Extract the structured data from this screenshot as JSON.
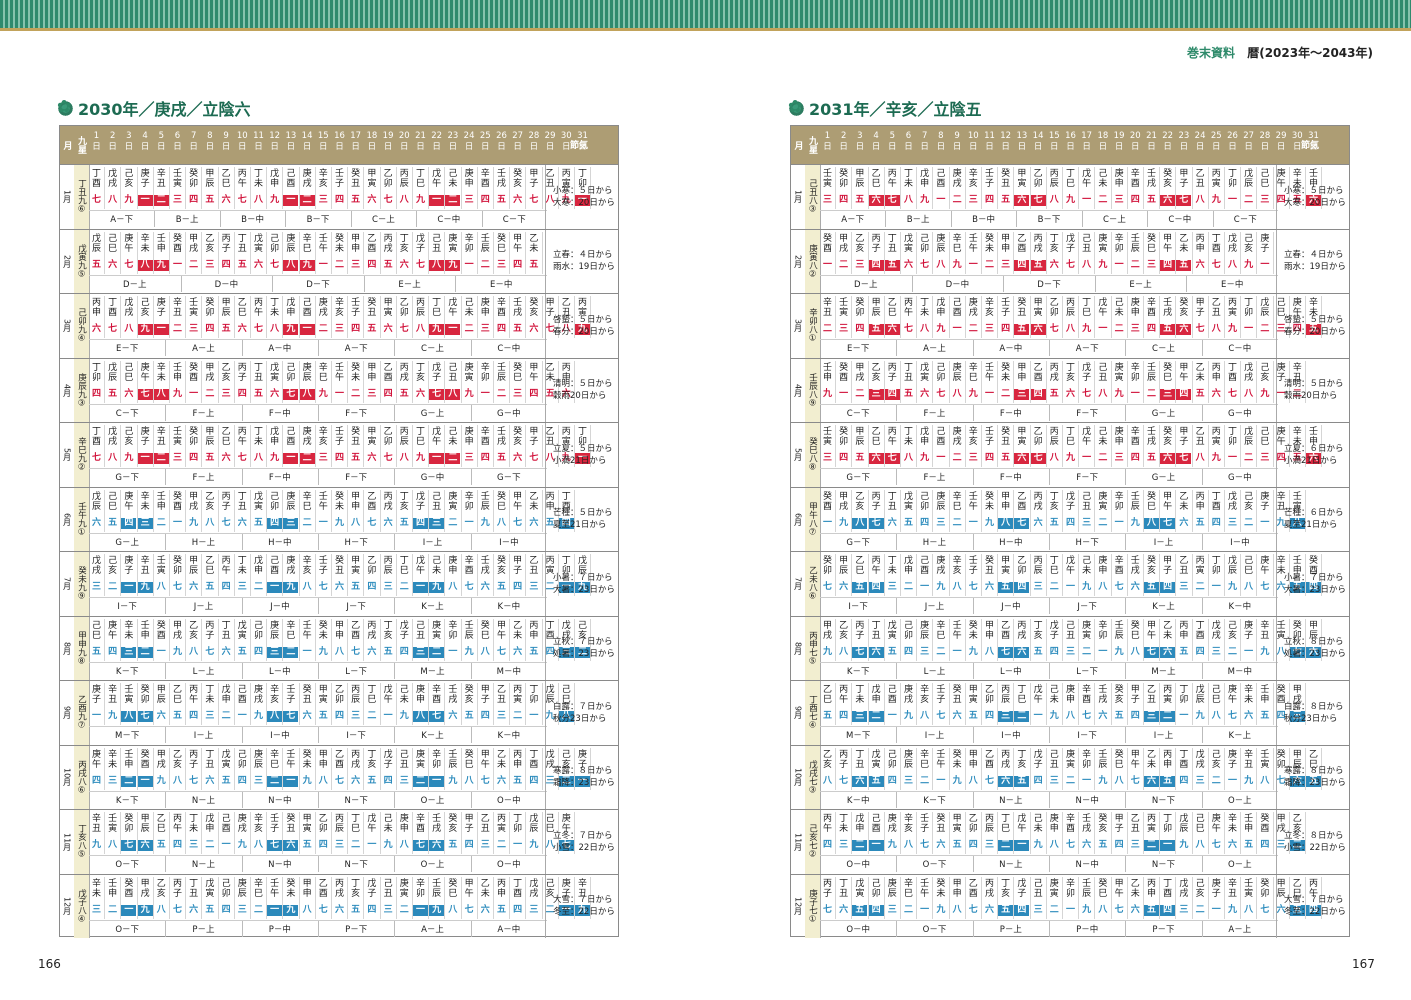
{
  "header": {
    "section": "巻末資料",
    "title": "暦(2023年～2043年)"
  },
  "header_labels": {
    "month": "月",
    "kyusei": "九星",
    "day_suffix": "日",
    "sekki": "節気"
  },
  "pages": [
    {
      "title": "2030年／庚戌／立陰六",
      "page_number": "166",
      "months": [
        {
          "label": "1月",
          "kyusei": "丁丑九⑥",
          "sekki": [
            "小寒：５日から",
            "大寒：20日から"
          ],
          "groups": [
            "A－下",
            "B－上",
            "B－中",
            "B－下",
            "C－上",
            "C－中",
            "C－下"
          ]
        },
        {
          "label": "2月",
          "kyusei": "戊寅九⑤",
          "sekki": [
            "立春：４日から",
            "雨水：19日から"
          ],
          "groups": [
            "D－上",
            "D－中",
            "D－下",
            "E－上",
            "E－中"
          ]
        },
        {
          "label": "3月",
          "kyusei": "己卯九④",
          "sekki": [
            "啓蟄：５日から",
            "春分：20日から"
          ],
          "groups": [
            "E－下",
            "A－上",
            "A－中",
            "A－下",
            "C－上",
            "C－中"
          ]
        },
        {
          "label": "4月",
          "kyusei": "庚辰九③",
          "sekki": [
            "清明：５日から",
            "穀雨20日から"
          ],
          "groups": [
            "C－下",
            "F－上",
            "F－中",
            "F－下",
            "G－上",
            "G－中"
          ]
        },
        {
          "label": "5月",
          "kyusei": "辛巳九②",
          "sekki": [
            "立夏：５日から",
            "小満21日から"
          ],
          "groups": [
            "G－下",
            "F－上",
            "F－中",
            "F－下",
            "G－中",
            "G－下"
          ]
        },
        {
          "label": "6月",
          "kyusei": "壬午九①",
          "sekki": [
            "芒種：５日から",
            "夏至21日から"
          ],
          "groups": [
            "G－上",
            "H－上",
            "H－中",
            "H－下",
            "I－上",
            "I－中"
          ]
        },
        {
          "label": "7月",
          "kyusei": "癸未九⑨",
          "sekki": [
            "小暑：７日から",
            "大暑：23日から"
          ],
          "groups": [
            "I－下",
            "J－上",
            "J－中",
            "J－下",
            "K－上",
            "K－中"
          ]
        },
        {
          "label": "8月",
          "kyusei": "甲申九⑧",
          "sekki": [
            "立秋：７日から",
            "処暑：23日から"
          ],
          "groups": [
            "K－下",
            "L－上",
            "L－中",
            "L－下",
            "M－上",
            "M－中"
          ]
        },
        {
          "label": "9月",
          "kyusei": "乙酉九⑦",
          "sekki": [
            "白露：７日から",
            "秋分23日から"
          ],
          "groups": [
            "M－下",
            "I－上",
            "I－中",
            "I－下",
            "K－上",
            "K－中"
          ]
        },
        {
          "label": "10月",
          "kyusei": "丙戌八⑥",
          "sekki": [
            "寒露：８日から",
            "霜降：23日から"
          ],
          "groups": [
            "K－下",
            "N－上",
            "N－中",
            "N－下",
            "O－上",
            "O－中"
          ]
        },
        {
          "label": "11月",
          "kyusei": "丁亥八⑤",
          "sekki": [
            "立冬：７日から",
            "小雪：22日から"
          ],
          "groups": [
            "O－下",
            "N－上",
            "N－中",
            "N－下",
            "O－上",
            "O－中"
          ]
        },
        {
          "label": "12月",
          "kyusei": "戊子八④",
          "sekki": [
            "大雪：７日から",
            "冬至：22日から"
          ],
          "groups": [
            "O－下",
            "P－上",
            "P－中",
            "P－下",
            "A－上",
            "A－中"
          ]
        }
      ]
    },
    {
      "title": "2031年／辛亥／立陰五",
      "page_number": "167",
      "months": [
        {
          "label": "1月",
          "kyusei": "己丑八③",
          "sekki": [
            "小寒：５日から",
            "大寒：20日から"
          ],
          "groups": [
            "A－下",
            "B－上",
            "B－中",
            "B－下",
            "C－上",
            "C－中",
            "C－下"
          ]
        },
        {
          "label": "2月",
          "kyusei": "庚寅八②",
          "sekki": [
            "立春：４日から",
            "雨水：19日から"
          ],
          "groups": [
            "D－上",
            "D－中",
            "D－下",
            "E－上",
            "E－中"
          ]
        },
        {
          "label": "3月",
          "kyusei": "辛卯八①",
          "sekki": [
            "啓蟄：５日から",
            "春分：20日から"
          ],
          "groups": [
            "E－下",
            "A－上",
            "A－中",
            "A－下",
            "C－上",
            "C－中"
          ]
        },
        {
          "label": "4月",
          "kyusei": "壬辰八⑨",
          "sekki": [
            "清明：５日から",
            "穀雨20日から"
          ],
          "groups": [
            "C－下",
            "F－上",
            "F－中",
            "F－下",
            "G－上",
            "G－中"
          ]
        },
        {
          "label": "5月",
          "kyusei": "癸巳八⑧",
          "sekki": [
            "立夏：６日から",
            "小満21日から"
          ],
          "groups": [
            "G－下",
            "F－上",
            "F－中",
            "F－下",
            "G－上",
            "G－中"
          ]
        },
        {
          "label": "6月",
          "kyusei": "甲午八⑦",
          "sekki": [
            "芒種：６日から",
            "夏至21日から"
          ],
          "groups": [
            "G－下",
            "H－上",
            "H－中",
            "H－下",
            "I－上",
            "I－中"
          ]
        },
        {
          "label": "7月",
          "kyusei": "乙未八⑥",
          "sekki": [
            "小暑：７日から",
            "大暑：23日から"
          ],
          "groups": [
            "I－下",
            "J－上",
            "J－中",
            "J－下",
            "K－上",
            "K－中"
          ]
        },
        {
          "label": "8月",
          "kyusei": "丙申七⑤",
          "sekki": [
            "立秋：８日から",
            "処暑：23日から"
          ],
          "groups": [
            "K－下",
            "L－上",
            "L－中",
            "L－下",
            "M－上",
            "M－中"
          ]
        },
        {
          "label": "9月",
          "kyusei": "丁酉七④",
          "sekki": [
            "白露：８日から",
            "秋分23日から"
          ],
          "groups": [
            "M－下",
            "I－上",
            "I－中",
            "I－下",
            "I－上",
            "K－上"
          ]
        },
        {
          "label": "10月",
          "kyusei": "戊戌七③",
          "sekki": [
            "寒露：８日から",
            "霜降：23日から"
          ],
          "groups": [
            "K－中",
            "K－下",
            "N－上",
            "N－中",
            "N－下",
            "O－上"
          ]
        },
        {
          "label": "11月",
          "kyusei": "己亥七②",
          "sekki": [
            "立冬：８日から",
            "小雪：22日から"
          ],
          "groups": [
            "O－中",
            "O－下",
            "N－上",
            "N－中",
            "N－下",
            "O－上"
          ]
        },
        {
          "label": "12月",
          "kyusei": "庚子七①",
          "sekki": [
            "大雪：７日から",
            "冬至：22日から"
          ],
          "groups": [
            "O－中",
            "O－下",
            "P－上",
            "P－中",
            "P－下",
            "A－上"
          ]
        }
      ]
    }
  ],
  "kanshi": [
    "甲子",
    "乙丑",
    "丙寅",
    "丁卯",
    "戊辰",
    "己巳",
    "庚午",
    "辛未",
    "壬申",
    "癸酉",
    "甲戌",
    "乙亥",
    "丙子",
    "丁丑",
    "戊寅",
    "己卯",
    "庚辰",
    "辛巳",
    "壬午",
    "癸未",
    "甲申",
    "乙酉",
    "丙戌",
    "丁亥",
    "戊子",
    "己丑",
    "庚寅",
    "辛卯",
    "壬辰",
    "癸巳",
    "甲午",
    "乙未",
    "丙申",
    "丁酉",
    "戊戌",
    "己亥",
    "庚子",
    "辛丑",
    "壬寅",
    "癸卯",
    "甲辰",
    "乙巳",
    "丙午",
    "丁未",
    "戊申",
    "己酉",
    "庚戌",
    "辛亥",
    "壬子",
    "癸丑",
    "甲寅",
    "乙卯",
    "丙辰",
    "丁巳",
    "戊午",
    "己未",
    "庚申",
    "辛酉",
    "壬戌",
    "癸亥"
  ],
  "numerals": [
    "一",
    "二",
    "三",
    "四",
    "五",
    "六",
    "七",
    "八",
    "九"
  ],
  "colors": {
    "accent": "#2e8a6a",
    "header_bg": "#ad9d74",
    "kyusei_bg": "#f2eed0",
    "red": "#d1123a",
    "blue": "#2b89bb"
  }
}
